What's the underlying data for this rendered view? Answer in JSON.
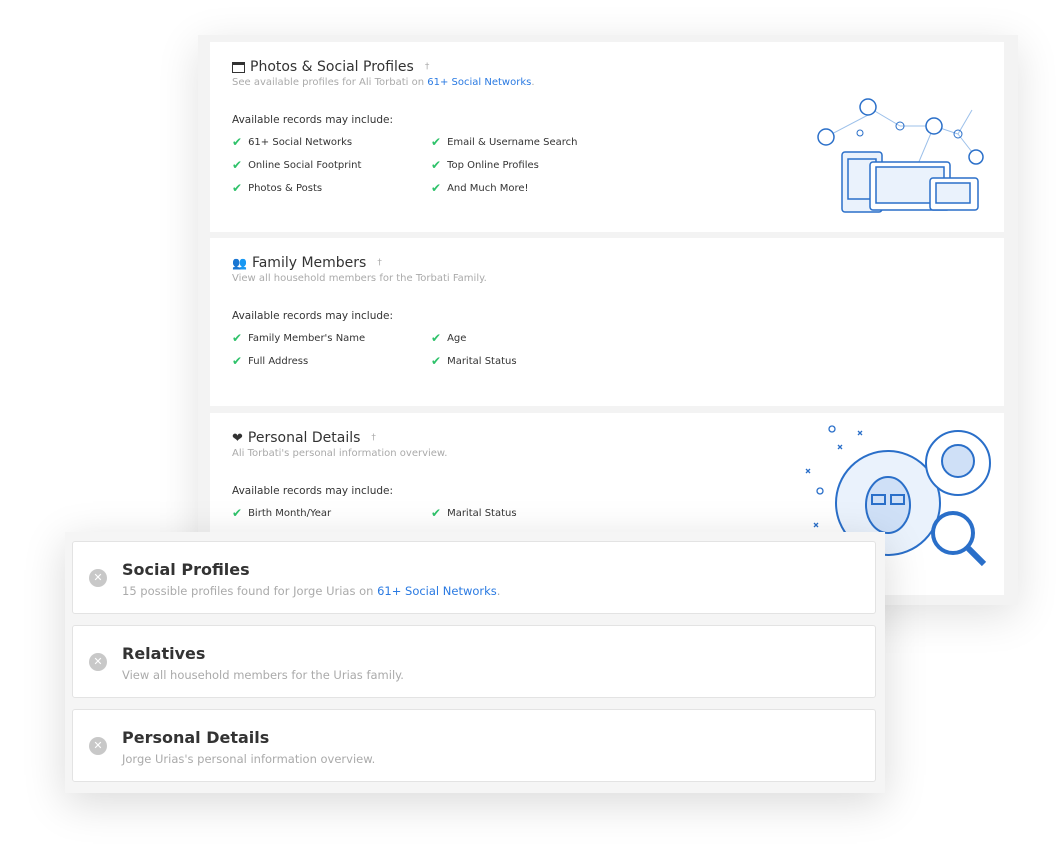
{
  "back_cards": [
    {
      "icon": "browser-window-icon",
      "title": "Photos & Social Profiles",
      "dagger": "†",
      "subtitle_pre": "See available profiles for Ali Torbati on ",
      "subtitle_link": "61+ Social Networks",
      "subtitle_post": ".",
      "available": "Available records may include:",
      "items": [
        "61+ Social Networks",
        "Email & Username Search",
        "Online Social Footprint",
        "Top Online Profiles",
        "Photos & Posts",
        "And Much More!"
      ]
    },
    {
      "icon": "users-icon",
      "title": "Family Members",
      "dagger": "†",
      "subtitle_pre": "View all household members for the Torbati Family.",
      "available": "Available records may include:",
      "items": [
        "Family Member's Name",
        "Age",
        "Full Address",
        "Marital Status"
      ]
    },
    {
      "icon": "heart-icon",
      "title": "Personal Details",
      "dagger": "†",
      "subtitle_pre": "Ali Torbati's personal information overview.",
      "available": "Available records may include:",
      "items": [
        "Birth Month/Year",
        "Marital Status"
      ]
    }
  ],
  "front_cards": [
    {
      "title": "Social Profiles",
      "subtitle_pre": "15 possible profiles found for Jorge Urias on ",
      "subtitle_link": "61+ Social Networks",
      "subtitle_post": "."
    },
    {
      "title": "Relatives",
      "subtitle_pre": "View all household members for the Urias family."
    },
    {
      "title": "Personal Details",
      "subtitle_pre": "Jorge Urias's personal information overview."
    }
  ],
  "colors": {
    "check": "#2ec26a",
    "link": "#2a7ae2",
    "illustration": "#2a6fc9"
  }
}
